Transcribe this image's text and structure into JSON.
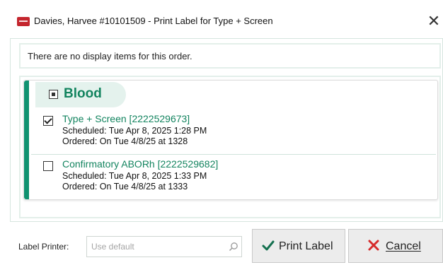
{
  "window": {
    "title": "Davies, Harvee #10101509 - Print Label for Type + Screen",
    "close_glyph": "✕"
  },
  "notice": {
    "text": "There are no display items for this order."
  },
  "group": {
    "label": "Blood",
    "items": [
      {
        "title": "Type + Screen [2222529673]",
        "scheduled": "Scheduled: Tue Apr 8, 2025 1:28 PM",
        "ordered": "Ordered: On Tue 4/8/25 at 1328",
        "checked": true
      },
      {
        "title": "Confirmatory ABORh [2222529682]",
        "scheduled": "Scheduled: Tue Apr 8, 2025 1:33 PM",
        "ordered": "Ordered: On Tue 4/8/25 at 1333",
        "checked": false
      }
    ]
  },
  "footer": {
    "printer_label": "Label Printer:",
    "printer_placeholder": "Use default",
    "printer_value": "",
    "print_button": "Print Label",
    "cancel_button": "Cancel"
  },
  "icons": {
    "app": "app-logo-icon",
    "close": "close-icon",
    "search": "search-icon",
    "print": "checkmark-icon",
    "cancel": "x-icon"
  },
  "colors": {
    "accent_green": "#109270",
    "title_green": "#13845f",
    "header_pill": "#e4f2ed",
    "cancel_red": "#d62b2b",
    "print_check": "#14704f"
  }
}
